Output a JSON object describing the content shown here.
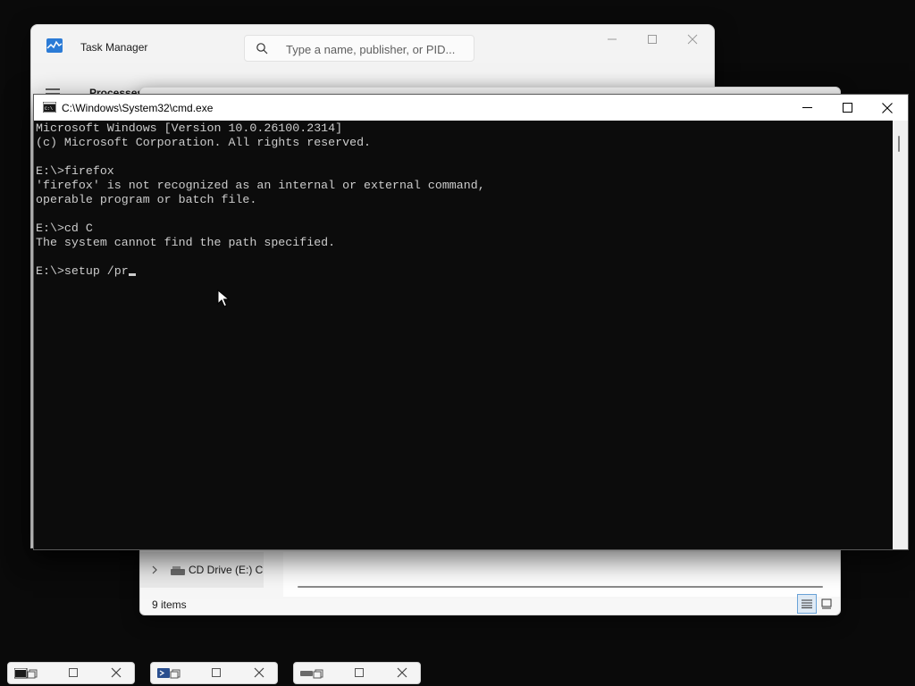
{
  "task_manager": {
    "title": "Task Manager",
    "search_placeholder": "Type a name, publisher, or PID...",
    "nav_label": "Processes"
  },
  "file_explorer": {
    "nav_drive_label": "CD Drive (E:) CC",
    "status_text": "9 items"
  },
  "cmd": {
    "title": "C:\\Windows\\System32\\cmd.exe",
    "lines": [
      "Microsoft Windows [Version 10.0.26100.2314]",
      "(c) Microsoft Corporation. All rights reserved.",
      "",
      "E:\\>firefox",
      "'firefox' is not recognized as an internal or external command,",
      "operable program or batch file.",
      "",
      "E:\\>cd C",
      "The system cannot find the path specified.",
      "",
      "E:\\>setup /pr"
    ]
  },
  "taskbar": {
    "items": [
      {
        "icon": "cmd-icon"
      },
      {
        "icon": "powershell-icon"
      },
      {
        "icon": "drive-icon"
      }
    ]
  },
  "colors": {
    "console_bg": "#0c0c0c",
    "console_fg": "#cccccc",
    "desktop_bg": "#0a0a0a",
    "selection_accent": "#6aa3d8"
  }
}
